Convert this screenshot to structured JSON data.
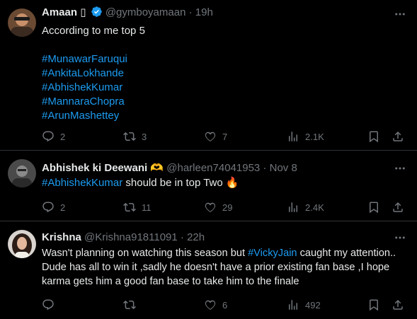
{
  "tweets": [
    {
      "name": "Amaan",
      "name_suffix": "▯",
      "handle": "@gymboyamaan",
      "time": "19h",
      "lines": [
        "According to me top 5"
      ],
      "hashtags": [
        "#MunawarFaruqui",
        "#AnkitaLokhande",
        "#AbhishekKumar",
        "#MannaraChopra",
        "#ArunMashettey"
      ],
      "replies": "2",
      "retweets": "3",
      "likes": "7",
      "views": "2.1K"
    },
    {
      "name": "Abhishek ki Deewani",
      "name_suffix": "🫶",
      "handle": "@harleen74041953",
      "time": "Nov 8",
      "tag": "#AbhishekKumar",
      "text_after_tag": " should be in top Two ",
      "emoji": "🔥",
      "replies": "2",
      "retweets": "11",
      "likes": "29",
      "views": "2.4K"
    },
    {
      "name": "Krishna",
      "handle": "@Krishna91811091",
      "time": "22h",
      "line1_before": "Wasn't planning on watching this season but ",
      "line1_tag": "#VickyJain",
      "line1_after": " caught my attention..",
      "line2": "Dude has all to win it ,sadly he doesn't have a prior existing fan base ,I hope",
      "line3": "karma gets him a good fan base to take him to the finale",
      "likes": "6",
      "views": "492"
    }
  ],
  "dot": "·",
  "colors": {
    "accent": "#1d9bf0",
    "muted": "#71767b",
    "text": "#e7e9ea",
    "background": "#000000",
    "verified": "#1d9bf0"
  },
  "icons": [
    "reply-icon",
    "retweet-icon",
    "like-icon",
    "views-icon",
    "bookmark-icon",
    "share-icon",
    "more-icon",
    "verified-badge-icon"
  ]
}
